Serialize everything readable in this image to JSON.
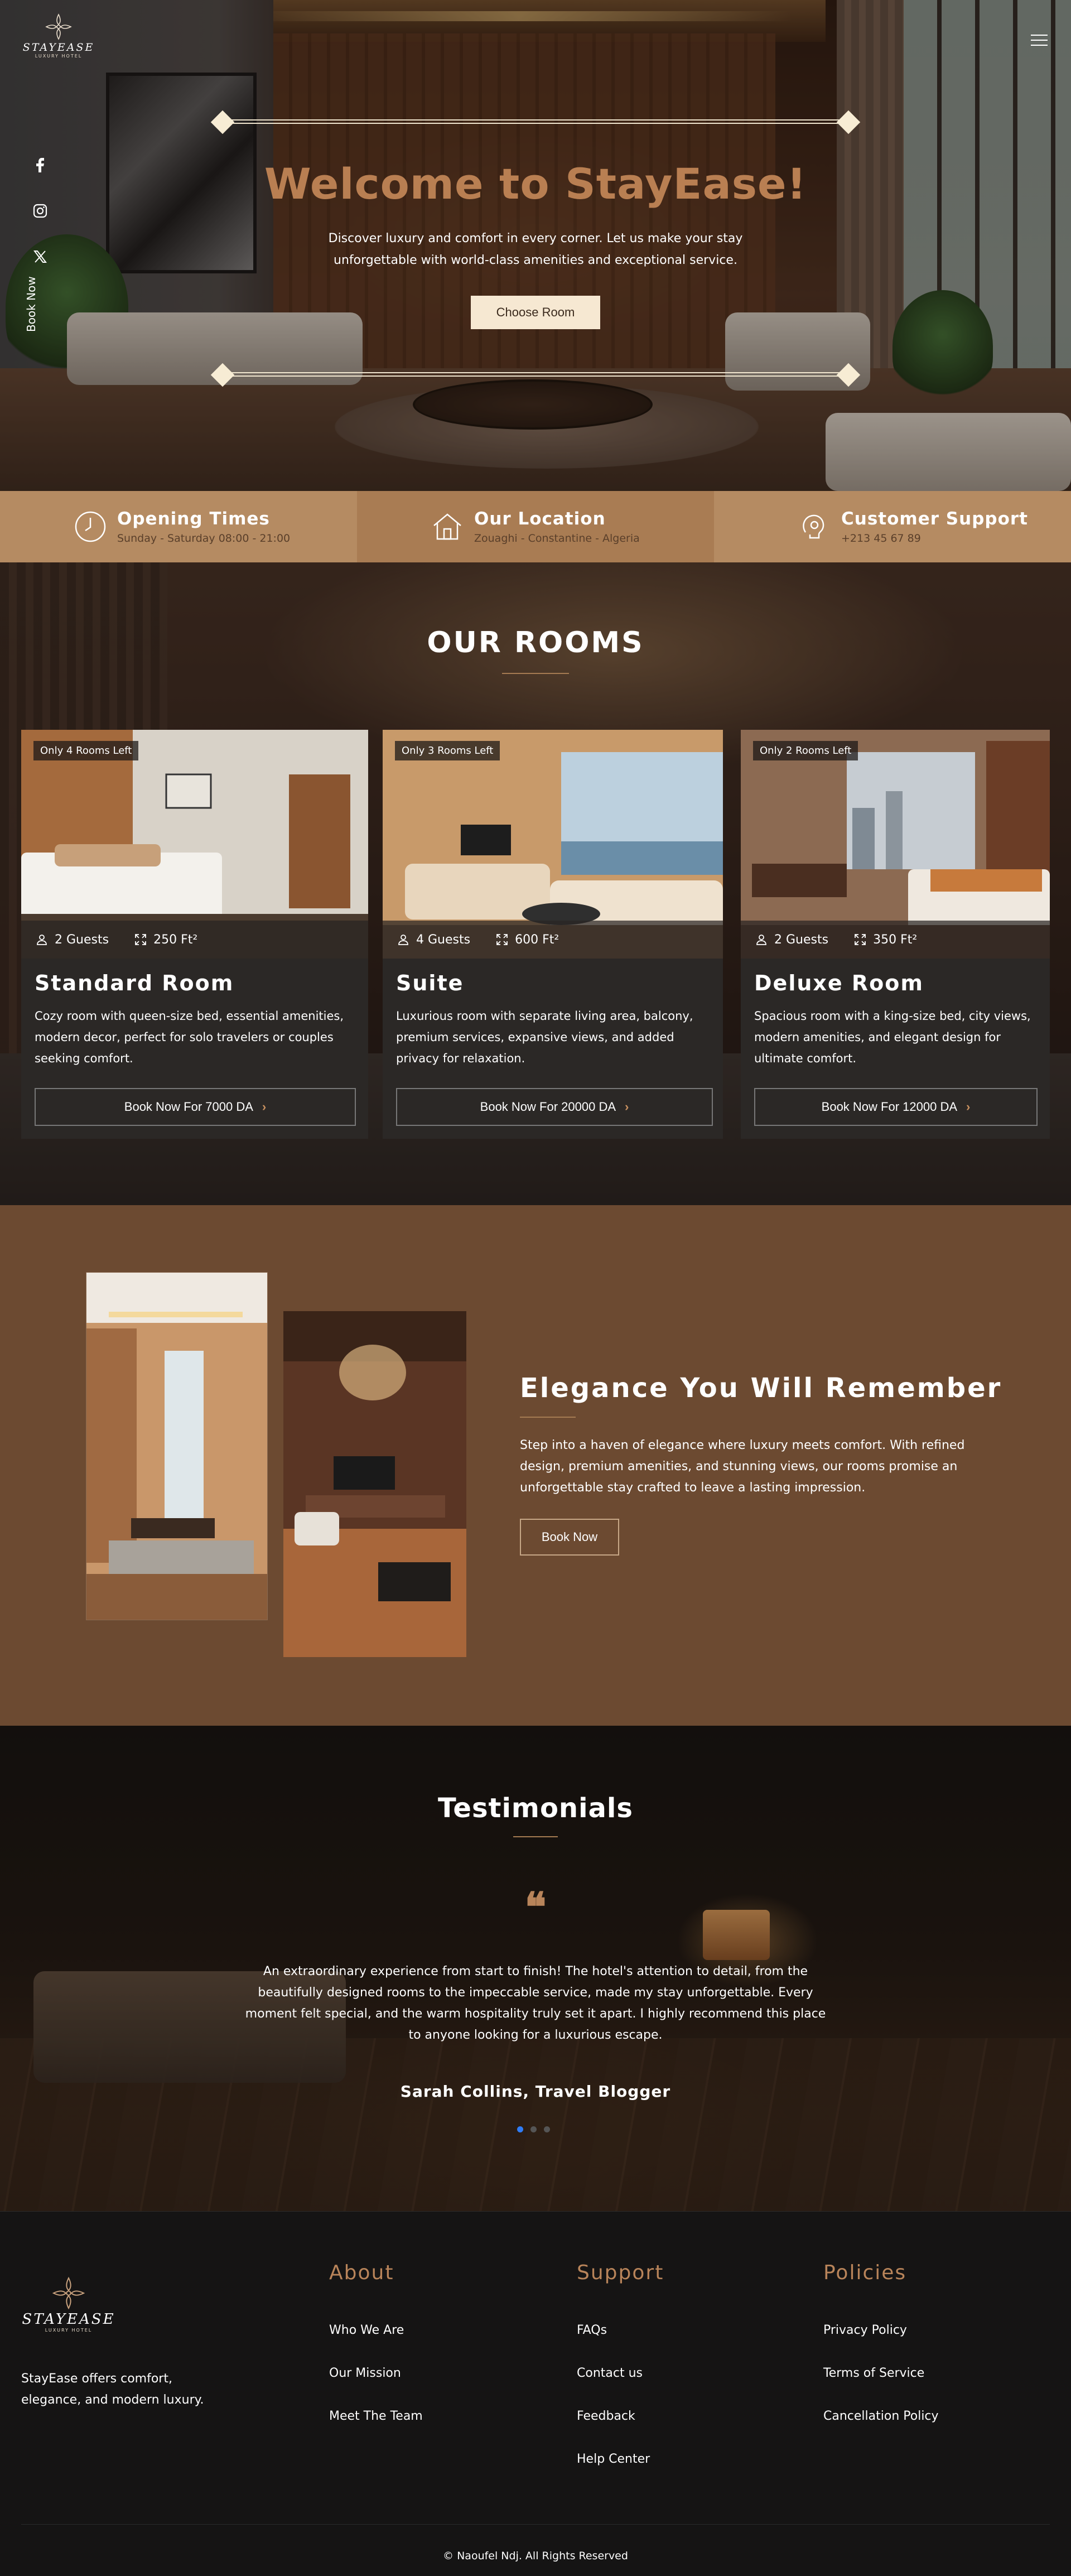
{
  "brand": {
    "name": "STAYEASE",
    "tagline": "LUXURY HOTEL"
  },
  "nav": {
    "menu_icon": "hamburger-menu-icon"
  },
  "social": {
    "items": [
      {
        "name": "facebook",
        "icon": "facebook-icon"
      },
      {
        "name": "instagram",
        "icon": "instagram-icon"
      },
      {
        "name": "x",
        "icon": "x-twitter-icon"
      }
    ],
    "book_now": "Book Now"
  },
  "hero": {
    "title": "Welcome to StayEase!",
    "description": "Discover luxury and comfort in every corner. Let us make your stay unforgettable with world-class amenities and exceptional service.",
    "cta": "Choose Room"
  },
  "info_bar": [
    {
      "icon": "clock-icon",
      "title": "Opening Times",
      "text": "Sunday - Saturday 08:00 - 21:00"
    },
    {
      "icon": "home-icon",
      "title": "Our Location",
      "text": "Zouaghi - Constantine - Algeria"
    },
    {
      "icon": "support-icon",
      "title": "Customer Support",
      "text": "+213 45 67 89"
    }
  ],
  "rooms": {
    "title": "OUR ROOMS",
    "cards": [
      {
        "badge": "Only 4 Rooms Left",
        "guests": "2 Guests",
        "area": "250 Ft²",
        "name": "Standard Room",
        "description": "Cozy room with queen-size bed, essential amenities, modern decor, perfect for solo travelers or couples seeking comfort.",
        "button": "Book Now For 7000 DA"
      },
      {
        "badge": "Only 3 Rooms Left",
        "guests": "4 Guests",
        "area": "600 Ft²",
        "name": "Suite",
        "description": "Luxurious room with separate living area, balcony, premium services, expansive views, and added privacy for relaxation.",
        "button": "Book Now For 20000 DA"
      },
      {
        "badge": "Only 2 Rooms Left",
        "guests": "2 Guests",
        "area": "350 Ft²",
        "name": "Deluxe Room",
        "description": "Spacious room with a king-size bed, city views, modern amenities, and elegant design for ultimate comfort.",
        "button": "Book Now For 12000 DA"
      }
    ]
  },
  "elegance": {
    "title": "Elegance You Will Remember",
    "description": "Step into a haven of elegance where luxury meets comfort. With refined design, premium amenities, and stunning views, our rooms promise an unforgettable stay crafted to leave a lasting impression.",
    "cta": "Book Now"
  },
  "testimonials": {
    "title": "Testimonials",
    "quote_mark": "❝",
    "text": "An extraordinary experience from start to finish! The hotel's attention to detail, from the beautifully designed rooms to the impeccable service, made my stay unforgettable. Every moment felt special, and the warm hospitality truly set it apart. I highly recommend this place to anyone looking for a luxurious escape.",
    "author": "Sarah Collins, Travel Blogger",
    "active_dot": 0
  },
  "footer": {
    "about_text": "StayEase offers comfort, elegance, and modern luxury.",
    "columns": [
      {
        "title": "About",
        "links": [
          "Who We Are",
          "Our Mission",
          "Meet The Team"
        ]
      },
      {
        "title": "Support",
        "links": [
          "FAQs",
          "Contact us",
          "Feedback",
          "Help Center"
        ]
      },
      {
        "title": "Policies",
        "links": [
          "Privacy Policy",
          "Terms of Service",
          "Cancellation Policy"
        ]
      }
    ],
    "copyright": "© Naoufel Ndj. All Rights Reserved"
  },
  "colors": {
    "accent": "#b8845a",
    "info_bar": "#b58b62",
    "elegance_bg": "#6c4a31",
    "footer_bg": "#151414",
    "active_dot": "#2f7cf6"
  }
}
